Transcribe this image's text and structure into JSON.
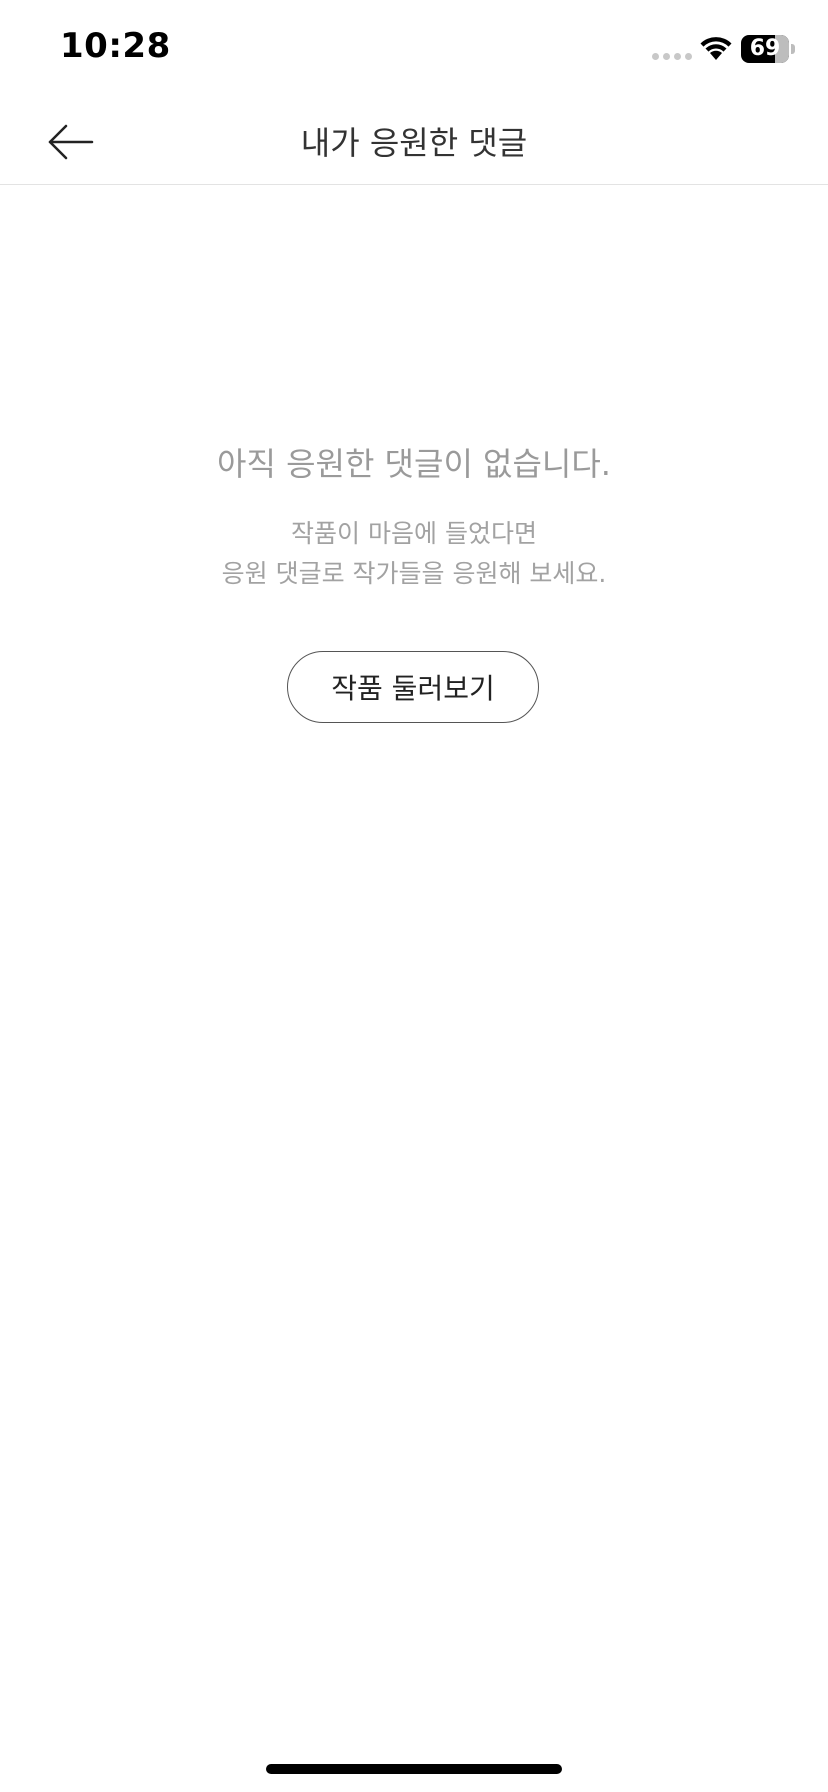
{
  "status_bar": {
    "time": "10:28",
    "battery": "69",
    "icons": [
      "signal-dots-icon",
      "wifi-icon",
      "battery-icon"
    ]
  },
  "header": {
    "back_icon": "arrow-left-icon",
    "title": "내가 응원한 댓글"
  },
  "empty_state": {
    "title": "아직 응원한 댓글이 없습니다.",
    "description_lines": [
      "작품이 마음에 들었다면",
      "응원 댓글로 작가들을 응원해 보세요."
    ],
    "button_label": "작품 둘러보기"
  },
  "colors": {
    "background": "#ffffff",
    "muted_text": "#9a9a9a",
    "divider": "#e3e3e3",
    "button_border": "#555555"
  }
}
